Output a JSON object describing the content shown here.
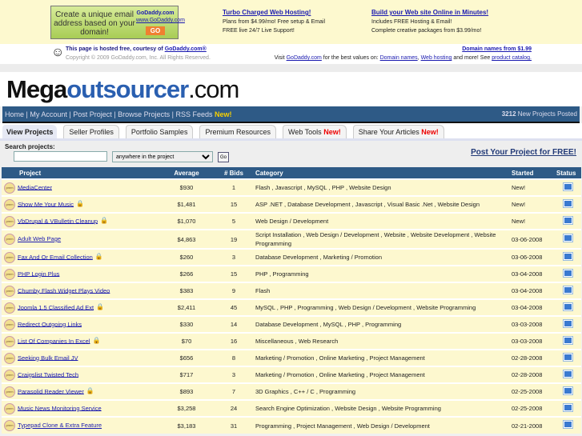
{
  "ad": {
    "banner_text": "Create a unique email address based on your domain!",
    "banner_brand": "GoDaddy.com",
    "banner_url": "www.GoDaddy.com",
    "banner_go": "GO",
    "col1": {
      "title": "Turbo Charged Web Hosting!",
      "line1": "Plans from $4.99/mo! Free setup & Email",
      "line2": "FREE live 24/7 Live Support!"
    },
    "col2": {
      "title": "Build your Web site Online in Minutes!",
      "line1": "Includes FREE Hosting & Email!",
      "line2": "Complete creative packages from $3.99/mo!"
    }
  },
  "host": {
    "hosted_prefix": "This page is hosted free, courtesy of ",
    "hosted_link": "GoDaddy.com®",
    "copyright": "Copyright © 2009 GoDaddy.com, Inc. All Rights Reserved.",
    "domain_link": "Domain names from $1.99",
    "visit_prefix": "Visit ",
    "visit_link": "GoDaddy.com",
    "visit_mid": " for the best values on: ",
    "link_domains": "Domain names",
    "link_hosting": "Web hosting",
    "visit_suffix": " and more! See ",
    "link_catalog": "product catalog."
  },
  "logo": {
    "part1": "Mega",
    "part2": "outsourcer",
    "part3": ".com"
  },
  "nav": {
    "items": [
      "Home",
      "My Account",
      "Post Project",
      "Browse Projects",
      "RSS Feeds"
    ],
    "new": "New!",
    "count": "3212",
    "count_label": " New Projects Posted"
  },
  "tabs": [
    {
      "label": "View Projects"
    },
    {
      "label": "Seller Profiles"
    },
    {
      "label": "Portfolio Samples"
    },
    {
      "label": "Premium Resources"
    },
    {
      "label": "Web Tools",
      "new": "New!"
    },
    {
      "label": "Share Your Articles",
      "new": "New!"
    }
  ],
  "search": {
    "label": "Search projects:",
    "value": "",
    "scope": "anywhere in the project",
    "go": "Go",
    "post_link": "Post Your Project for FREE!"
  },
  "table": {
    "headers": [
      "Project",
      "Average",
      "# Bids",
      "Category",
      "Started",
      "Status"
    ],
    "rows": [
      {
        "name": "MediaCenter",
        "lock": false,
        "avg": "$930",
        "bids": "1",
        "cat": "Flash , Javascript , MySQL , PHP , Website Design",
        "started": "New!"
      },
      {
        "name": "Show Me Your Music",
        "lock": true,
        "avg": "$1,481",
        "bids": "15",
        "cat": "ASP .NET , Database Development , Javascript , Visual Basic .Net , Website Design",
        "started": "New!"
      },
      {
        "name": "VbDrupal & VBulletin Cleanup",
        "lock": true,
        "avg": "$1,070",
        "bids": "5",
        "cat": "Web Design / Development",
        "started": "New!"
      },
      {
        "name": "Adult Web Page",
        "lock": false,
        "avg": "$4,863",
        "bids": "19",
        "cat": "Script Installation , Web Design / Development , Website , Website Development , Website Programming",
        "started": "03-06-2008"
      },
      {
        "name": "Fax And Or Email Collection",
        "lock": true,
        "avg": "$260",
        "bids": "3",
        "cat": "Database Development , Marketing / Promotion",
        "started": "03-06-2008"
      },
      {
        "name": "PHP Login Plus",
        "lock": false,
        "avg": "$266",
        "bids": "15",
        "cat": "PHP , Programming",
        "started": "03-04-2008"
      },
      {
        "name": "Chumby Flash Widget Plays Video",
        "lock": false,
        "avg": "$383",
        "bids": "9",
        "cat": "Flash",
        "started": "03-04-2008"
      },
      {
        "name": "Joomla 1.5 Classified Ad Ext",
        "lock": true,
        "avg": "$2,411",
        "bids": "45",
        "cat": "MySQL , PHP , Programming , Web Design / Development , Website Programming",
        "started": "03-04-2008"
      },
      {
        "name": "Redirect Outgoing Links",
        "lock": false,
        "avg": "$330",
        "bids": "14",
        "cat": "Database Development , MySQL , PHP , Programming",
        "started": "03-03-2008"
      },
      {
        "name": "List Of Companies In Excel",
        "lock": true,
        "avg": "$70",
        "bids": "16",
        "cat": "Miscellaneous , Web Research",
        "started": "03-03-2008"
      },
      {
        "name": "Seeking Bulk Email JV",
        "lock": false,
        "avg": "$656",
        "bids": "8",
        "cat": "Marketing / Promotion , Online Marketing , Project Management",
        "started": "02-28-2008"
      },
      {
        "name": "Craigslist Twisted Tech",
        "lock": false,
        "avg": "$717",
        "bids": "3",
        "cat": "Marketing / Promotion , Online Marketing , Project Management",
        "started": "02-28-2008"
      },
      {
        "name": "Parasolid Reader Viewer",
        "lock": true,
        "avg": "$893",
        "bids": "7",
        "cat": "3D Graphics , C++ / C , Programming",
        "started": "02-25-2008"
      },
      {
        "name": "Music News Monitoring Service",
        "lock": false,
        "avg": "$3,258",
        "bids": "24",
        "cat": "Search Engine Optimization , Website Design , Website Programming",
        "started": "02-25-2008"
      },
      {
        "name": "Typepad Clone & Extra Feature",
        "lock": false,
        "avg": "$3,183",
        "bids": "31",
        "cat": "Programming , Project Management , Web Design / Development",
        "started": "02-21-2008"
      }
    ]
  }
}
